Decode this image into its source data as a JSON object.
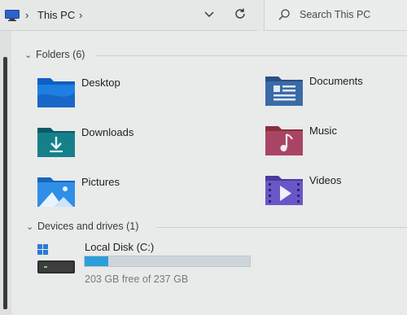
{
  "address_bar": {
    "location": "This PC",
    "location_icon": "computer-monitor-icon"
  },
  "search": {
    "placeholder": "Search This PC"
  },
  "groups": {
    "folders": {
      "title": "Folders (6)",
      "items": [
        {
          "label": "Desktop",
          "icon": "desktop-folder-icon"
        },
        {
          "label": "Documents",
          "icon": "documents-folder-icon"
        },
        {
          "label": "Downloads",
          "icon": "downloads-folder-icon"
        },
        {
          "label": "Music",
          "icon": "music-folder-icon"
        },
        {
          "label": "Pictures",
          "icon": "pictures-folder-icon"
        },
        {
          "label": "Videos",
          "icon": "videos-folder-icon"
        }
      ]
    },
    "drives": {
      "title": "Devices and drives (1)",
      "items": [
        {
          "label": "Local Disk (C:)",
          "icon": "hard-drive-windows-icon",
          "free_text": "203 GB free of 237 GB",
          "used_fraction": 0.143
        }
      ]
    }
  },
  "colors": {
    "drive_fill": "#2c9fd9",
    "drive_track": "#cfd6db",
    "background": "#e9eaea"
  }
}
